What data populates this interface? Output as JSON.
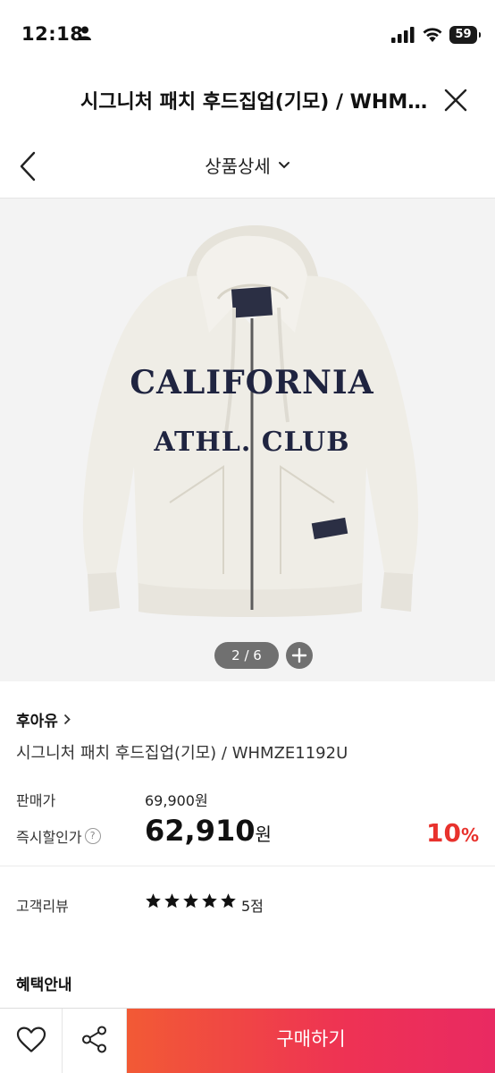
{
  "status": {
    "time": "12:18",
    "battery": "59"
  },
  "browser": {
    "title": "시그니처 패치 후드집업(기모) / WHMZE1192U",
    "close_icon": "close-icon"
  },
  "nav": {
    "title": "상품상세",
    "back_icon": "chevron-left-icon",
    "dropdown_icon": "chevron-down-icon"
  },
  "gallery": {
    "image_alt": "cream zip-up hoodie with navy CALIFORNIA ATHL. CLUB lettering",
    "print_line1": "CALIFORNIA",
    "print_line2": "ATHL. CLUB",
    "counter": "2 / 6"
  },
  "product": {
    "brand": "후아유",
    "name": "시그니처 패치 후드집업(기모) / WHMZE1192U",
    "price_label": "판매가",
    "price": "69,900원",
    "sale_label": "즉시할인가",
    "sale_price": "62,910",
    "sale_unit": "원",
    "discount": "10",
    "discount_unit": "%",
    "review_label": "고객리뷰",
    "rating": 5,
    "rating_text": "5점",
    "benefit_title": "혜택안내"
  },
  "bottom": {
    "buy_label": "구매하기"
  },
  "colors": {
    "accent": "#e8322d",
    "buy_gradient_start": "#f25a35",
    "buy_gradient_end": "#e92a62"
  }
}
